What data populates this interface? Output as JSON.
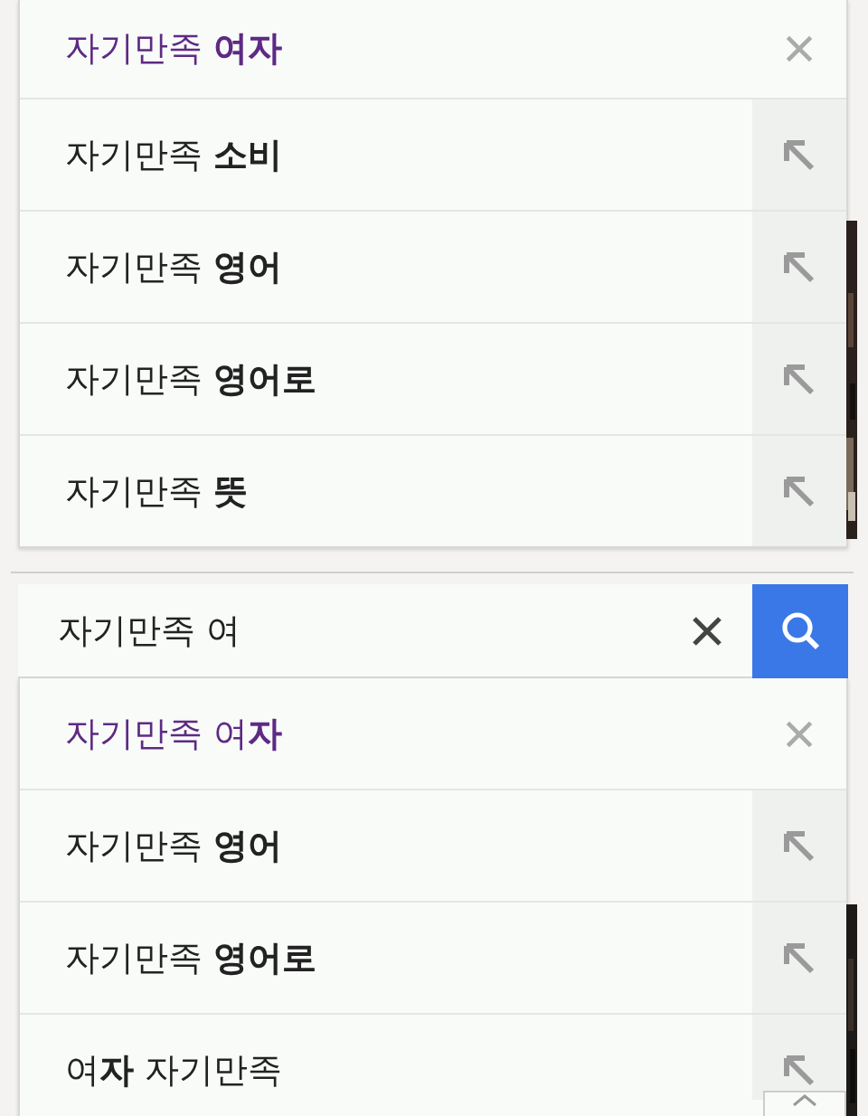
{
  "top_suggestions": [
    {
      "kind": "history",
      "text": "자기만족 **여자**"
    },
    {
      "kind": "suggestion",
      "text": "자기만족 **소비**"
    },
    {
      "kind": "suggestion",
      "text": "자기만족 **영어**"
    },
    {
      "kind": "suggestion",
      "text": "자기만족 **영어로**"
    },
    {
      "kind": "suggestion",
      "text": "자기만족 **뜻**"
    }
  ],
  "search": {
    "value": "자기만족 여"
  },
  "bottom_suggestions": [
    {
      "kind": "history",
      "text": "자기만족 여**자**"
    },
    {
      "kind": "suggestion",
      "text": "자기만족 **영어**"
    },
    {
      "kind": "suggestion",
      "text": "자기만족 **영어로**"
    },
    {
      "kind": "suggestion",
      "text": "여**자** 자기만족"
    }
  ]
}
